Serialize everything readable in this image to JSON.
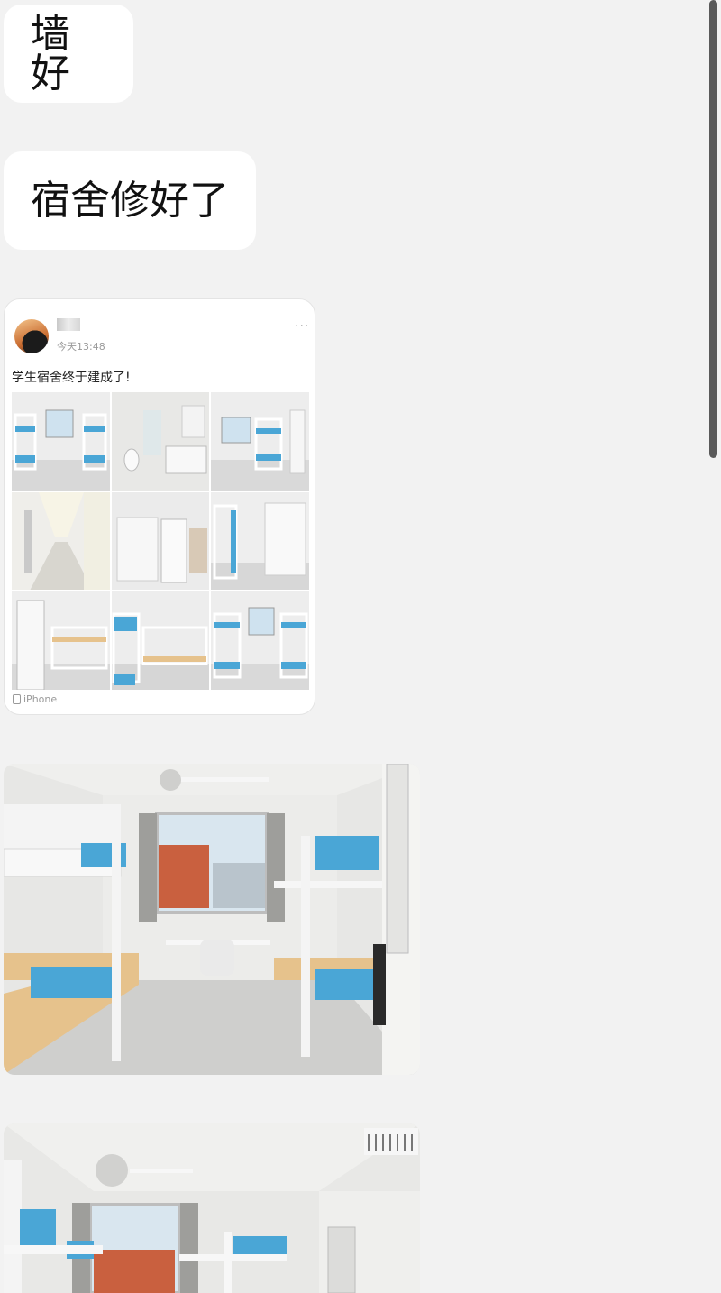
{
  "messages": [
    {
      "text": "墙好"
    },
    {
      "text": "宿舍修好了"
    }
  ],
  "shared_post": {
    "time": "今天13:48",
    "more_icon": "more-dots-icon",
    "text": "学生宿舍终于建成了!",
    "device": "iPhone",
    "device_icon": "phone-icon",
    "photo_count": 9
  },
  "photos": [
    {
      "subject": "dorm-room-bunk-beds-window"
    },
    {
      "subject": "dorm-room-bunk-beds-ac"
    }
  ],
  "colors": {
    "background": "#f2f2f2",
    "bubble": "#ffffff",
    "bed_blue": "#4aa6d6",
    "wood": "#e6c28c"
  }
}
